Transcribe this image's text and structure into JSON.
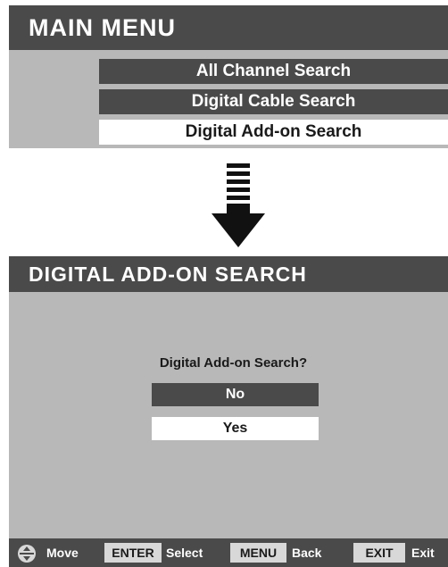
{
  "main_menu": {
    "title": "MAIN MENU",
    "items": [
      {
        "label": "All Channel Search",
        "selected": false
      },
      {
        "label": "Digital Cable Search",
        "selected": false
      },
      {
        "label": "Digital Add-on Search",
        "selected": true
      }
    ]
  },
  "transition_icon": "down-arrow-icon",
  "search_screen": {
    "title": "DIGITAL ADD-ON SEARCH",
    "question": "Digital Add-on Search?",
    "options": [
      {
        "label": "No",
        "highlighted": true
      },
      {
        "label": "Yes",
        "highlighted": false
      }
    ]
  },
  "footer": {
    "move": {
      "icon": "navigation-pad-icon",
      "label": "Move"
    },
    "enter": {
      "key": "ENTER",
      "label": "Select"
    },
    "menu": {
      "key": "MENU",
      "label": "Back"
    },
    "exit": {
      "key": "EXIT",
      "label": "Exit"
    }
  },
  "colors": {
    "header": "#4a4a4a",
    "panel": "#b8b8b8",
    "selected": "#ffffff",
    "key_bg": "#d8d8d8"
  }
}
